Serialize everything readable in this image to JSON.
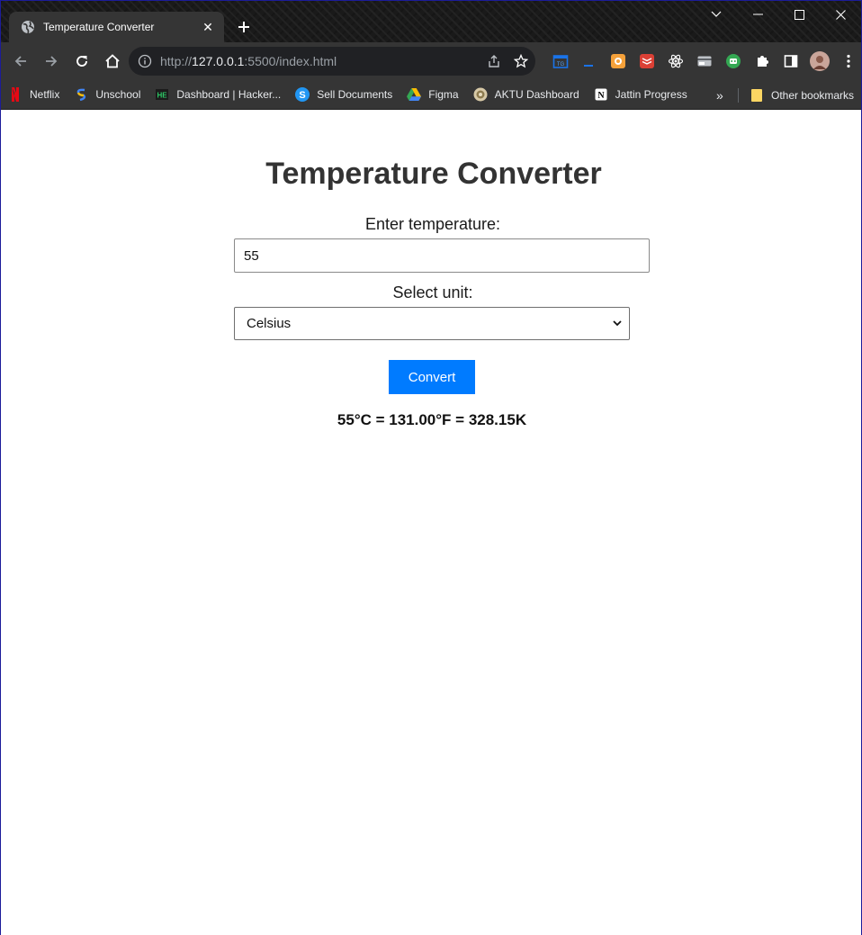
{
  "browser": {
    "tab_title": "Temperature Converter",
    "url_scheme": "http://",
    "url_host": "127.0.0.1",
    "url_rest": ":5500/index.html",
    "bookmarks": [
      {
        "label": "Netflix",
        "icon": "netflix-icon"
      },
      {
        "label": "Unschool",
        "icon": "unschool-icon"
      },
      {
        "label": "Dashboard | Hacker...",
        "icon": "hackerearth-icon"
      },
      {
        "label": "Sell Documents",
        "icon": "sell-documents-icon"
      },
      {
        "label": "Figma",
        "icon": "google-drive-icon"
      },
      {
        "label": "AKTU Dashboard",
        "icon": "aktu-icon"
      },
      {
        "label": "Jattin Progress",
        "icon": "notion-icon"
      }
    ],
    "bookmarks_more": "»",
    "other_bookmarks": "Other bookmarks"
  },
  "page": {
    "title": "Temperature Converter",
    "temp_label": "Enter temperature:",
    "temp_value": "55",
    "unit_label": "Select unit:",
    "unit_selected": "Celsius",
    "convert_label": "Convert",
    "result": "55°C = 131.00°F = 328.15K"
  },
  "colors": {
    "button": "#007bff",
    "title": "#333333"
  }
}
